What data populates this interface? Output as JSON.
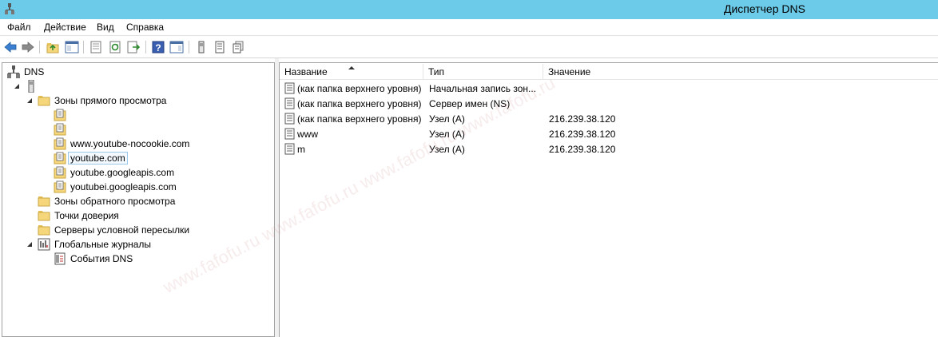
{
  "window": {
    "title": "Диспетчер DNS"
  },
  "menu": [
    "Файл",
    "Действие",
    "Вид",
    "Справка"
  ],
  "tree": {
    "root": "DNS",
    "forward_zones": "Зоны прямого просмотра",
    "zones": [
      "www.youtube-nocookie.com",
      "youtube.com",
      "youtube.googleapis.com",
      "youtubei.googleapis.com"
    ],
    "reverse_zones": "Зоны обратного просмотра",
    "trust_points": "Точки доверия",
    "conditional_forwarders": "Серверы условной пересылки",
    "global_logs": "Глобальные журналы",
    "dns_events": "События DNS"
  },
  "list": {
    "columns": [
      "Название",
      "Тип",
      "Значение"
    ],
    "rows": [
      {
        "name": "(как папка верхнего уровня)",
        "type": "Начальная запись зон...",
        "value": ""
      },
      {
        "name": "(как папка верхнего уровня)",
        "type": "Сервер имен (NS)",
        "value": ""
      },
      {
        "name": "(как папка верхнего уровня)",
        "type": "Узел (A)",
        "value": "216.239.38.120"
      },
      {
        "name": "www",
        "type": "Узел (A)",
        "value": "216.239.38.120"
      },
      {
        "name": "m",
        "type": "Узел (A)",
        "value": "216.239.38.120"
      }
    ]
  },
  "watermark": "www.fafofu.ru www.fafofu.ru www.fafofu.ru www.fafofu.ru",
  "colors": {
    "titlebar": "#6ccbe9",
    "folder": "#f5d67b",
    "selection_border": "#99c8ea"
  }
}
